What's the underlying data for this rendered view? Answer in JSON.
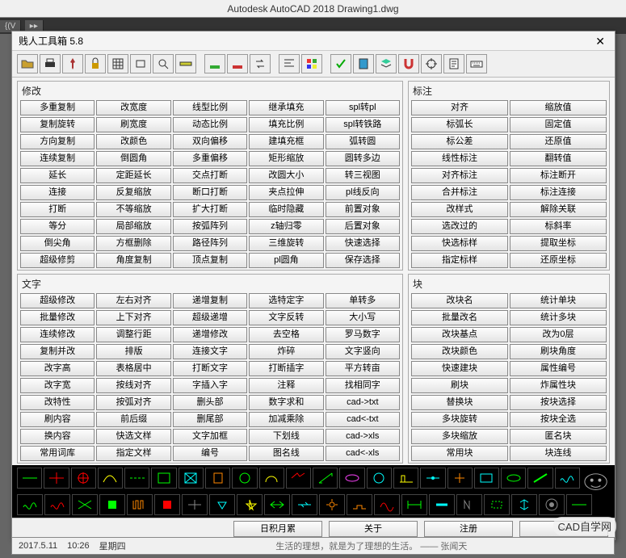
{
  "app_title": "Autodesk AutoCAD 2018      Drawing1.dwg",
  "window_title": "贱人工具箱 5.8",
  "close": "✕",
  "toolbar_icons": [
    "open",
    "print",
    "pin",
    "lock",
    "grid",
    "rect",
    "zoom",
    "ruler",
    "base1",
    "base2",
    "swap",
    "align",
    "color",
    "check",
    "book",
    "layer",
    "magnet",
    "target",
    "report",
    "keyboard"
  ],
  "panels": {
    "modify": {
      "title": "修改",
      "rows": [
        [
          "多重复制",
          "改宽度",
          "线型比例",
          "继承填充",
          "spl转pl"
        ],
        [
          "复制旋转",
          "刷宽度",
          "动态比例",
          "填充比例",
          "spl转铁路"
        ],
        [
          "方向复制",
          "改颜色",
          "双向偏移",
          "建填充框",
          "弧转圆"
        ],
        [
          "连续复制",
          "倒圆角",
          "多重偏移",
          "矩形缩放",
          "圆转多边"
        ],
        [
          "延长",
          "定距延长",
          "交点打断",
          "改圆大小",
          "转三视图"
        ],
        [
          "连接",
          "反复缩放",
          "断口打断",
          "夹点拉伸",
          "pl线反向"
        ],
        [
          "打断",
          "不等缩放",
          "扩大打断",
          "临时隐藏",
          "前置对象"
        ],
        [
          "等分",
          "局部缩放",
          "按弧阵列",
          "z轴归零",
          "后置对象"
        ],
        [
          "倒尖角",
          "方框删除",
          "路径阵列",
          "三维旋转",
          "快速选择"
        ],
        [
          "超级修剪",
          "角度复制",
          "顶点复制",
          "pl圆角",
          "保存选择"
        ]
      ]
    },
    "text": {
      "title": "文字",
      "rows": [
        [
          "超级修改",
          "左右对齐",
          "递增复制",
          "选特定字",
          "单转多"
        ],
        [
          "批量修改",
          "上下对齐",
          "超级递增",
          "文字反转",
          "大小写"
        ],
        [
          "连续修改",
          "调整行距",
          "递增修改",
          "去空格",
          "罗马数字"
        ],
        [
          "复制并改",
          "排版",
          "连接文字",
          "炸碎",
          "文字竖向"
        ],
        [
          "改字高",
          "表格居中",
          "打断文字",
          "打断插字",
          "平方转亩"
        ],
        [
          "改字宽",
          "按线对齐",
          "字插入字",
          "注释",
          "找相同字"
        ],
        [
          "改特性",
          "按弧对齐",
          "删头部",
          "数字求和",
          "cad->txt"
        ],
        [
          "刷内容",
          "前后缀",
          "删尾部",
          "加减乘除",
          "cad<-txt"
        ],
        [
          "换内容",
          "快选文样",
          "文字加框",
          "下划线",
          "cad->xls"
        ],
        [
          "常用词库",
          "指定文样",
          "编号",
          "图名线",
          "cad<-xls"
        ]
      ]
    },
    "dim": {
      "title": "标注",
      "rows": [
        [
          "对齐",
          "缩放值"
        ],
        [
          "标弧长",
          "固定值"
        ],
        [
          "标公差",
          "还原值"
        ],
        [
          "线性标注",
          "翻转值"
        ],
        [
          "对齐标注",
          "标注断开"
        ],
        [
          "合并标注",
          "标注连接"
        ],
        [
          "改样式",
          "解除关联"
        ],
        [
          "选改过的",
          "标斜率"
        ],
        [
          "快选标样",
          "提取坐标"
        ],
        [
          "指定标样",
          "还原坐标"
        ]
      ]
    },
    "block": {
      "title": "块",
      "rows": [
        [
          "改块名",
          "统计单块"
        ],
        [
          "批量改名",
          "统计多块"
        ],
        [
          "改块基点",
          "改为0层"
        ],
        [
          "改块颜色",
          "刷块角度"
        ],
        [
          "快速建块",
          "属性编号"
        ],
        [
          "刷块",
          "炸属性块"
        ],
        [
          "替换块",
          "按块选择"
        ],
        [
          "多块旋转",
          "按块全选"
        ],
        [
          "多块缩放",
          "匿名块"
        ],
        [
          "常用块",
          "块连线"
        ]
      ]
    }
  },
  "bottom_buttons": [
    "日积月累",
    "关于",
    "注册",
    ">>"
  ],
  "status": {
    "date": "2017.5.11",
    "time": "10:26",
    "weekday": "星期四",
    "msg": "生活的理想，就是为了理想的生活。 —— 张闻天"
  },
  "brand": "CAD自学网"
}
